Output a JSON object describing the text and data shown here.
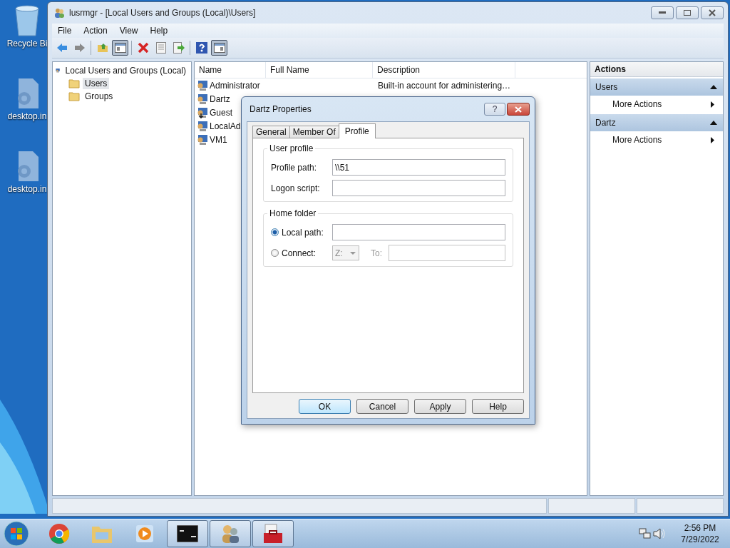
{
  "desktop_icons": [
    {
      "label": "Recycle Bi",
      "kind": "bin"
    },
    {
      "label": "desktop.in",
      "kind": "settings-file"
    },
    {
      "label": "desktop.in",
      "kind": "settings-file"
    }
  ],
  "window": {
    "title": "lusrmgr - [Local Users and Groups (Local)\\Users]"
  },
  "menu": [
    "File",
    "Action",
    "View",
    "Help"
  ],
  "toolbar": [
    [
      {
        "kind": "back",
        "pressed": false
      },
      {
        "kind": "forward",
        "pressed": false
      }
    ],
    [
      {
        "kind": "up",
        "pressed": false
      },
      {
        "kind": "tree-pane",
        "pressed": true
      }
    ],
    [
      {
        "kind": "delete",
        "pressed": false
      },
      {
        "kind": "properties",
        "pressed": false
      },
      {
        "kind": "export",
        "pressed": false
      }
    ],
    [
      {
        "kind": "help",
        "pressed": false
      },
      {
        "kind": "action-pane",
        "pressed": true
      }
    ]
  ],
  "tree": {
    "label": "Local Users and Groups (Local)",
    "children": [
      {
        "label": "Users",
        "selected": true
      },
      {
        "label": "Groups",
        "selected": false
      }
    ]
  },
  "list": {
    "columns": [
      "Name",
      "Full Name",
      "Description"
    ],
    "rows": [
      {
        "name": "Administrator",
        "description": "Built-in account for administering…",
        "kind": "user"
      },
      {
        "name": "Dartz",
        "kind": "user"
      },
      {
        "name": "Guest",
        "kind": "disabled-user"
      },
      {
        "name": "LocalAd",
        "kind": "user"
      },
      {
        "name": "VM1",
        "kind": "user"
      }
    ]
  },
  "actions": {
    "title": "Actions",
    "sections": [
      {
        "title": "Users",
        "expanded": true,
        "items": [
          "More Actions"
        ]
      },
      {
        "title": "Dartz",
        "expanded": true,
        "items": [
          "More Actions"
        ]
      }
    ]
  },
  "dialog": {
    "title": "Dartz Properties",
    "help_button": "?",
    "tabs": [
      {
        "label": "General",
        "selected": false
      },
      {
        "label": "Member Of",
        "selected": false
      },
      {
        "label": "Profile",
        "selected": true
      }
    ],
    "user_profile": {
      "legend": "User profile",
      "fields": [
        {
          "label": "Profile path:",
          "value": "\\\\51"
        },
        {
          "label": "Logon script:"
        }
      ]
    },
    "home_folder": {
      "legend": "Home folder",
      "local_path": {
        "label": "Local path:",
        "selected": true
      },
      "connect": {
        "label": "Connect:",
        "selected": false,
        "drive": "Z:",
        "to_label": "To:",
        "disabled": true
      }
    },
    "buttons": [
      {
        "label": "OK",
        "default": true
      },
      {
        "label": "Cancel",
        "default": false
      },
      {
        "label": "Apply",
        "default": false
      },
      {
        "label": "Help",
        "default": false
      }
    ]
  },
  "taskbar": {
    "items": [
      {
        "kind": "browser",
        "open": false
      },
      {
        "kind": "folder",
        "open": false
      },
      {
        "kind": "media",
        "open": false
      },
      {
        "kind": "terminal",
        "open": true
      },
      {
        "kind": "users",
        "open": true
      },
      {
        "kind": "toolbox",
        "open": true
      }
    ],
    "time": "2:56 PM",
    "date": "7/29/2022"
  }
}
